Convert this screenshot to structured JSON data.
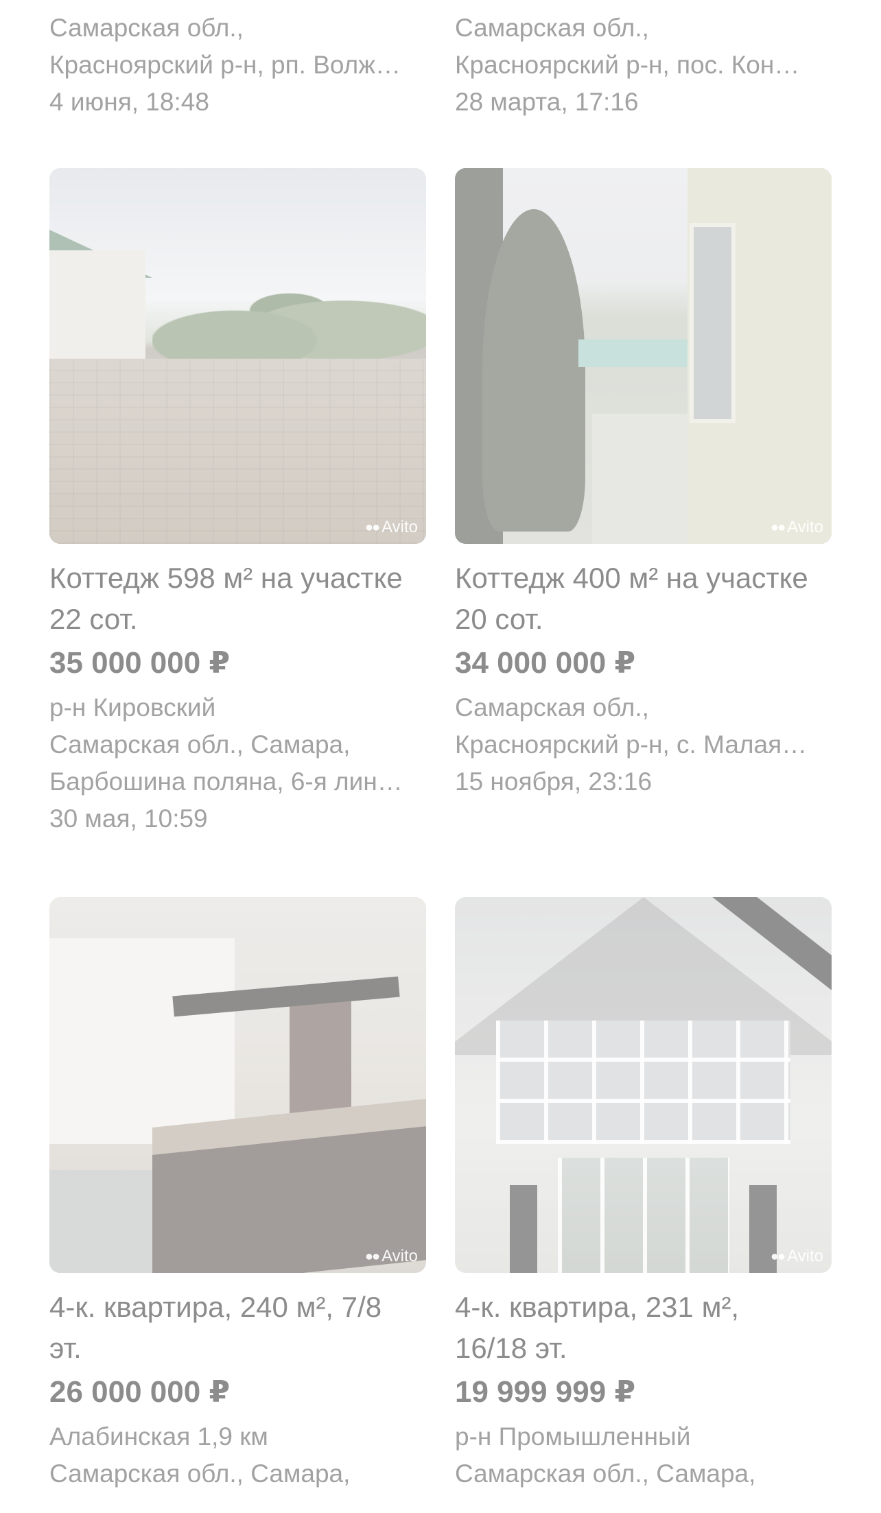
{
  "listings": [
    {
      "title": "",
      "price": "",
      "address_lines": [
        "Самарская обл.,",
        "Красноярский р-н, рп. Волж…"
      ],
      "date": "4 июня, 18:48"
    },
    {
      "title": "",
      "price": "",
      "address_lines": [
        "Самарская обл.,",
        "Красноярский р-н, пос. Кон…"
      ],
      "date": "28 марта, 17:16"
    },
    {
      "title": "Коттедж 598 м² на участке 22 сот.",
      "price": "35 000 000 ₽",
      "address_lines": [
        "р-н Кировский",
        "Самарская обл., Самара,",
        "Барбошина поляна, 6-я лин…"
      ],
      "date": "30 мая, 10:59",
      "watermark": "Avito"
    },
    {
      "title": "Коттедж 400 м² на участке 20 сот.",
      "price": "34 000 000 ₽",
      "address_lines": [
        "Самарская обл.,",
        "Красноярский р-н, с. Малая…"
      ],
      "date": "15 ноября, 23:16",
      "watermark": "Avito"
    },
    {
      "title": "4-к. квартира, 240 м², 7/8 эт.",
      "price": "26 000 000 ₽",
      "address_lines": [
        "Алабинская 1,9 км",
        "Самарская обл., Самара,"
      ],
      "date": "",
      "watermark": "Avito"
    },
    {
      "title": "4-к. квартира, 231 м², 16/18 эт.",
      "price": "19 999 999 ₽",
      "address_lines": [
        "р-н Промышленный",
        "Самарская обл., Самара,"
      ],
      "date": "",
      "watermark": "Avito"
    }
  ],
  "colors": {
    "text": "#8c8c8c",
    "meta": "#a2a2a2",
    "background": "#ffffff"
  },
  "icons": {
    "watermark": "avito-logo-icon"
  }
}
